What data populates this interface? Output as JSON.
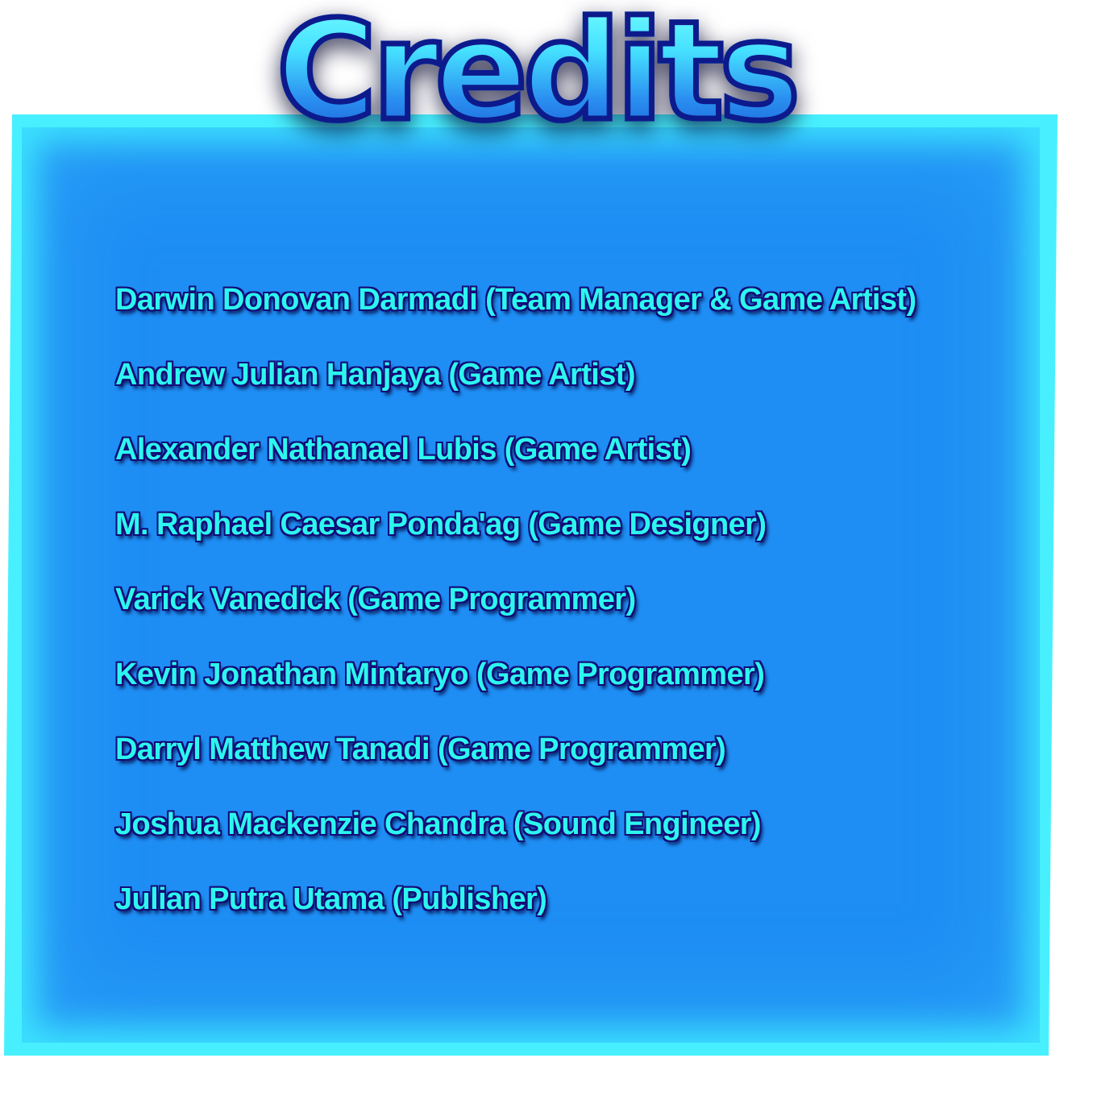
{
  "title": "Credits",
  "credits": [
    "Darwin Donovan Darmadi (Team Manager & Game Artist)",
    "Andrew Julian Hanjaya (Game Artist)",
    "Alexander Nathanael Lubis (Game Artist)",
    "M. Raphael Caesar Ponda'ag (Game Designer)",
    "Varick Vanedick (Game Programmer)",
    "Kevin Jonathan Mintaryo (Game Programmer)",
    "Darryl Matthew Tanadi (Game Programmer)",
    "Joshua Mackenzie Chandra (Sound Engineer)",
    "Julian Putra Utama (Publisher)"
  ],
  "colors": {
    "panel_border": "#48f0ff",
    "panel_fill": "#1e8ef4",
    "text_fill": "#2cf6ee",
    "text_outline": "#150a78",
    "title_outline": "#0d1a8c"
  }
}
